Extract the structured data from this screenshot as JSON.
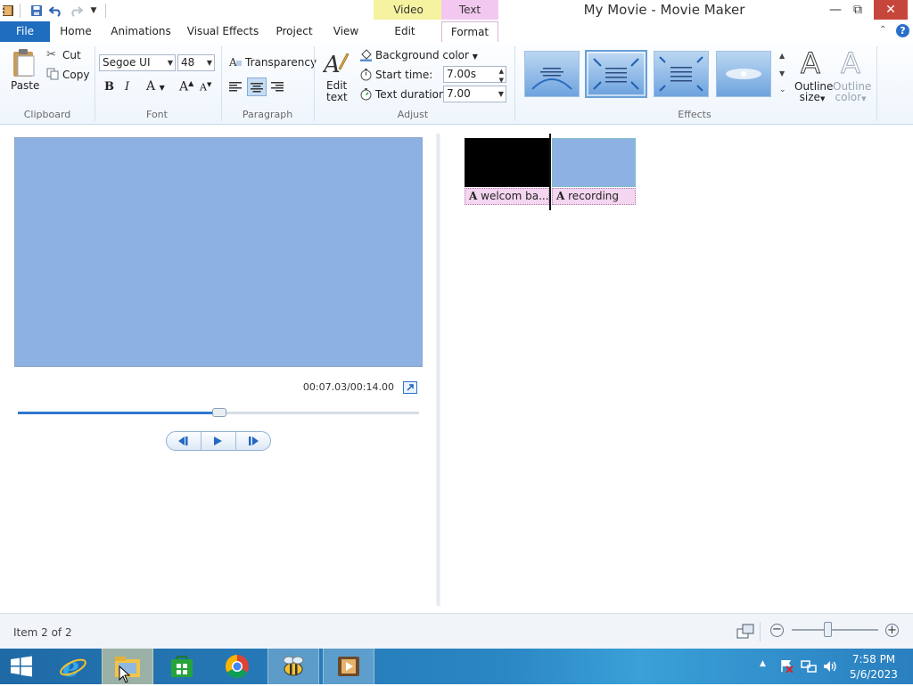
{
  "window": {
    "title": "My Movie - Movie Maker",
    "minimize_glyph": "—",
    "maximize_glyph": "⧉",
    "close_glyph": "✕"
  },
  "quick_access": {
    "app_icon": "film-icon",
    "save_icon": "save-icon",
    "undo_icon": "undo-icon",
    "redo_icon": "redo-icon",
    "customize_icon": "chevron-down-icon"
  },
  "context_tabs": {
    "video_tools": "Video Tools",
    "text_tools": "Text Tools"
  },
  "tabs": {
    "file": "File",
    "home": "Home",
    "animations": "Animations",
    "visual_effects": "Visual Effects",
    "project": "Project",
    "view": "View",
    "edit": "Edit",
    "format": "Format"
  },
  "ribbon": {
    "clipboard": {
      "label": "Clipboard",
      "paste": "Paste",
      "cut": "Cut",
      "copy": "Copy"
    },
    "font": {
      "label": "Font",
      "family": "Segoe UI",
      "size": "48",
      "bold": "B",
      "italic": "I",
      "color": "A",
      "grow": "A",
      "shrink": "A"
    },
    "paragraph": {
      "label": "Paragraph",
      "transparency": "Transparency"
    },
    "adjust": {
      "label": "Adjust",
      "edit_text_line1": "Edit",
      "edit_text_line2": "text",
      "background_color": "Background color",
      "start_time_label": "Start time:",
      "start_time_value": "7.00s",
      "text_duration_label": "Text duration:",
      "text_duration_value": "7.00"
    },
    "effects": {
      "label": "Effects",
      "outline_size_line1": "Outline",
      "outline_size_line2": "size",
      "outline_color_line1": "Outline",
      "outline_color_line2": "color"
    }
  },
  "preview": {
    "time": "00:07.03/00:14.00",
    "progress": 0.503
  },
  "storyboard": {
    "clips": [
      {
        "caption": "welcom ba..."
      },
      {
        "caption": "recording"
      }
    ]
  },
  "status": {
    "item_text": "Item 2 of 2"
  },
  "taskbar": {
    "time": "7:58 PM",
    "date": "5/6/2023"
  },
  "colors": {
    "file_tab": "#1e6dbf",
    "video_tools_tab": "#f6f3a0",
    "text_tools_tab": "#f3c8f0",
    "preview_bg": "#8eb1e3",
    "close_button": "#c7463b"
  }
}
